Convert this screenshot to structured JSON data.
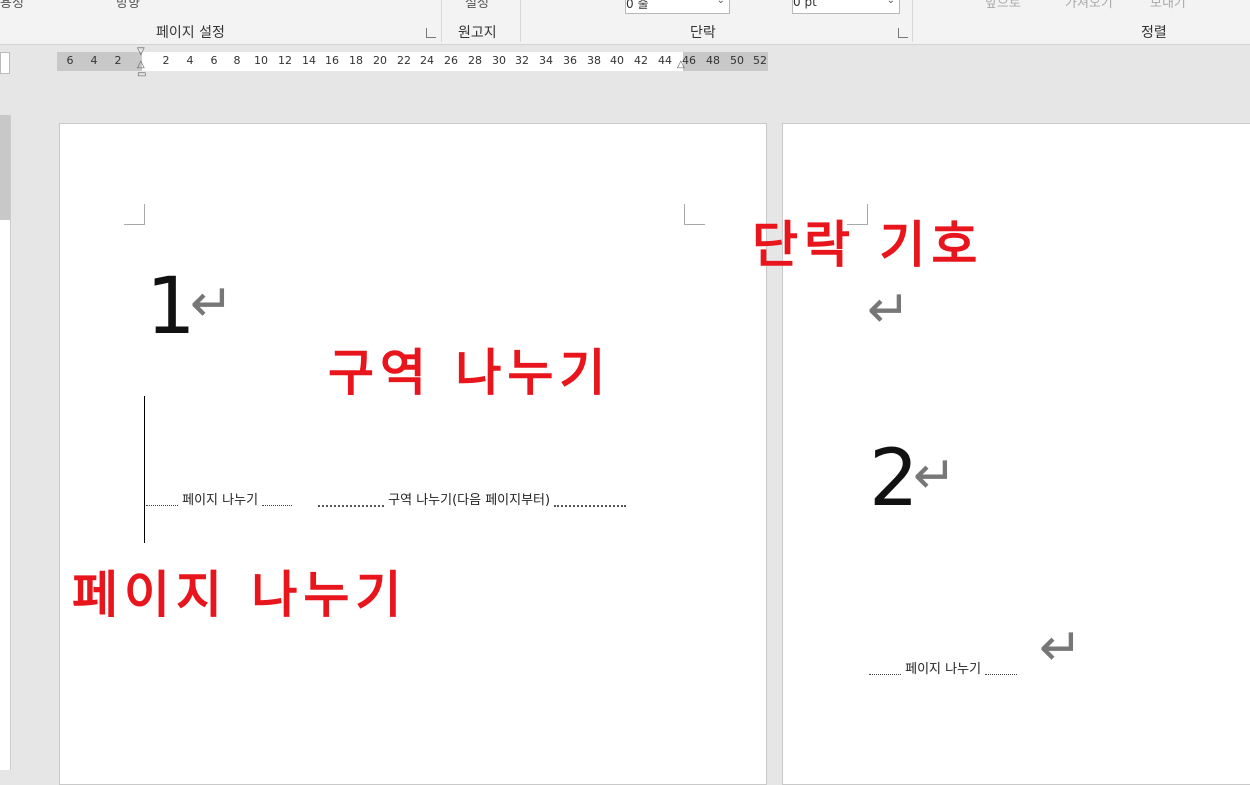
{
  "ribbon": {
    "groups": [
      {
        "label": "페이지 설정"
      },
      {
        "label": "원고지"
      },
      {
        "label": "단락"
      },
      {
        "label": "정렬"
      }
    ],
    "cut_texts": [
      "용정",
      "방향",
      "설정"
    ],
    "spin_before_value": "0 줄",
    "spin_after_value": "0 pt",
    "faded_buttons": [
      "앞으로",
      "가져오기",
      "모내기"
    ]
  },
  "ruler": {
    "ticks": [
      "6",
      "4",
      "2",
      "2",
      "4",
      "6",
      "8",
      "10",
      "12",
      "14",
      "16",
      "18",
      "20",
      "22",
      "24",
      "26",
      "28",
      "30",
      "32",
      "34",
      "36",
      "38",
      "40",
      "42",
      "44",
      "46",
      "48",
      "50",
      "52"
    ]
  },
  "document": {
    "page1": {
      "number": "1",
      "para_mark": "↵",
      "page_break_label": "페이지 나누기",
      "section_break_label": "구역 나누기(다음 페이지부터)"
    },
    "page2": {
      "empty_para_mark": "↵",
      "number": "2",
      "para_mark": "↵",
      "page_break_mark": "↵",
      "page_break_label": "페이지 나누기"
    }
  },
  "annotations": {
    "section_break": "구역 나누기",
    "page_break": "페이지 나누기",
    "paragraph_mark": "단락 기호",
    "color": "#e8161c"
  }
}
